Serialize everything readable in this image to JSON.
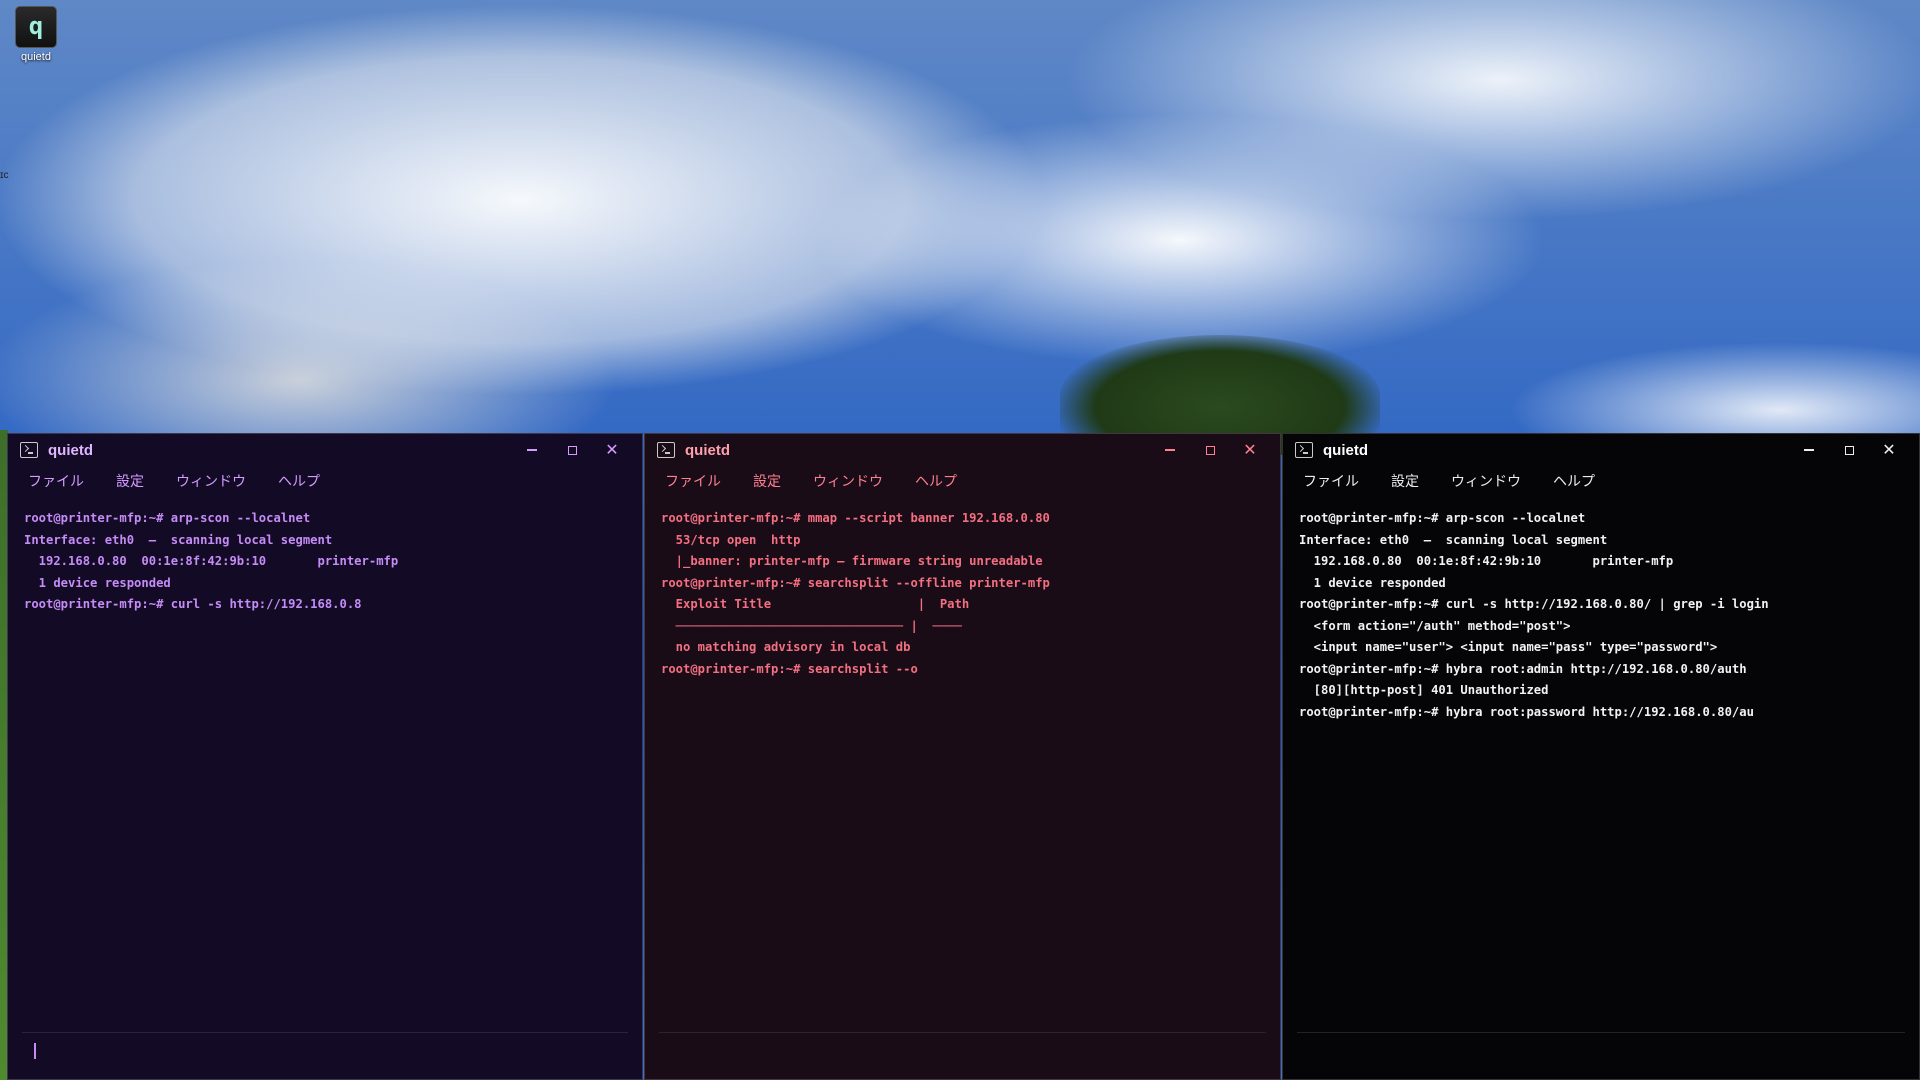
{
  "desktop": {
    "icon_glyph": "q",
    "icon_label": "quietd",
    "edge_text": "ɪc"
  },
  "windows": [
    {
      "title": "quietd",
      "menu": [
        "ファイル",
        "設定",
        "ウィンドウ",
        "ヘルプ"
      ],
      "lines": [
        "root@printer-mfp:~# arp-scon --localnet",
        "Interface: eth0  —  scanning local segment",
        "  192.168.0.80  00:1e:8f:42:9b:10       printer-mfp",
        "  1 device responded",
        "root@printer-mfp:~# curl -s http://192.168.0.8"
      ],
      "input_cursor": "|"
    },
    {
      "title": "quietd",
      "menu": [
        "ファイル",
        "設定",
        "ウィンドウ",
        "ヘルプ"
      ],
      "lines": [
        "root@printer-mfp:~# mmap --script banner 192.168.0.80",
        "  53/tcp open  http",
        "  |_banner: printer-mfp — firmware string unreadable",
        "root@printer-mfp:~# searchsplit --offline printer-mfp",
        "  Exploit Title                    |  Path",
        "  ─────────────────────────────── |  ────",
        "  no matching advisory in local db",
        "root@printer-mfp:~# searchsplit --o"
      ]
    },
    {
      "title": "quietd",
      "menu": [
        "ファイル",
        "設定",
        "ウィンドウ",
        "ヘルプ"
      ],
      "lines": [
        "root@printer-mfp:~# arp-scon --localnet",
        "Interface: eth0  —  scanning local segment",
        "  192.168.0.80  00:1e:8f:42:9b:10       printer-mfp",
        "  1 device responded",
        "root@printer-mfp:~# curl -s http://192.168.0.80/ | grep -i login",
        "  <form action=\"/auth\" method=\"post\">",
        "  <input name=\"user\"> <input name=\"pass\" type=\"password\">",
        "root@printer-mfp:~# hybra root:admin http://192.168.0.80/auth",
        "  [80][http-post] 401 Unauthorized",
        "root@printer-mfp:~# hybra root:password http://192.168.0.80/au"
      ]
    }
  ],
  "controls": {
    "minimize_glyph": "—",
    "close_glyph": "✕"
  },
  "colors": {
    "window1_text": "#c58cf6",
    "window2_text": "#f46f82",
    "window3_text": "#f2f2f2"
  }
}
